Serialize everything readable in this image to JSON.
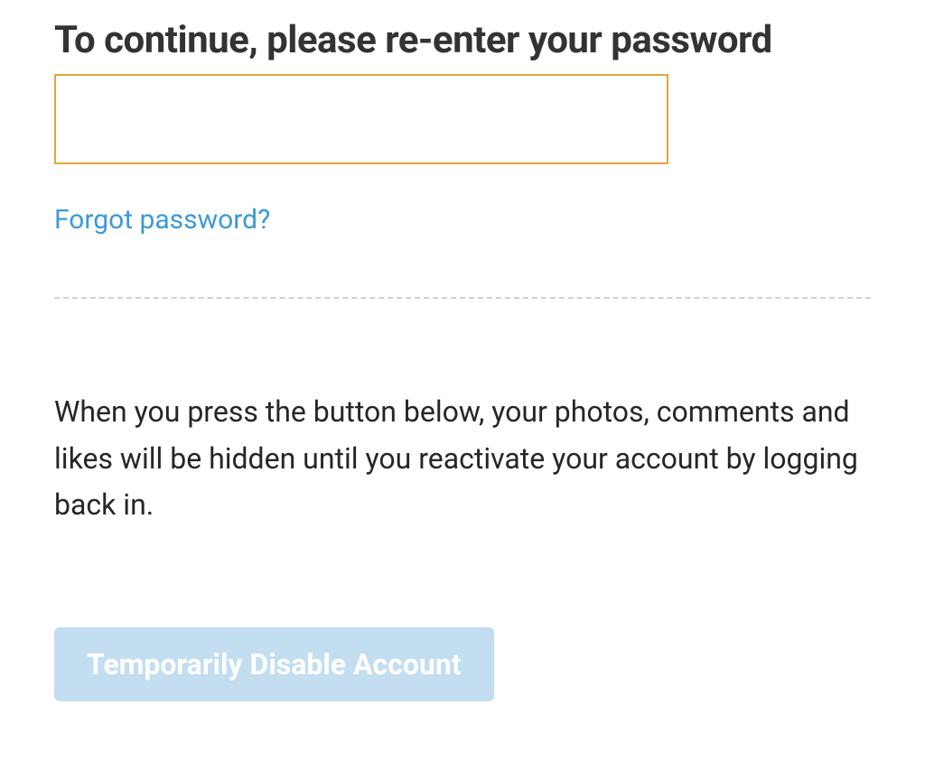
{
  "heading": "To continue, please re-enter your password",
  "password_value": "",
  "forgot_link_label": "Forgot password?",
  "info_text": "When you press the button below, your photos, comments and likes will be hidden until you reactivate your account by logging back in.",
  "disable_button_label": "Temporarily Disable Account",
  "colors": {
    "input_border": "#e5a53a",
    "link": "#3a9ad9",
    "button_bg": "#c3ddf1",
    "text": "#333333"
  }
}
